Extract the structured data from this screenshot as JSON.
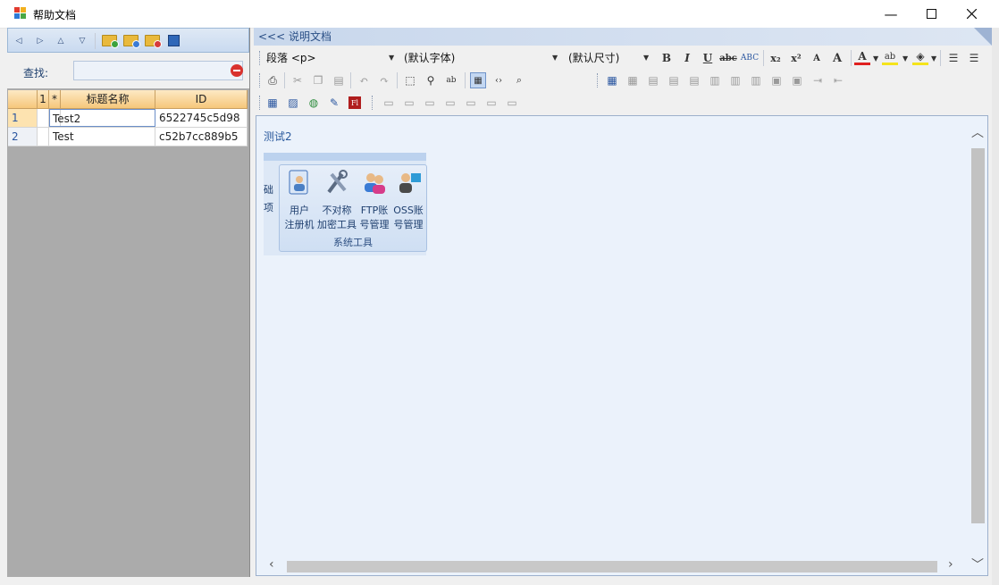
{
  "window": {
    "title": "帮助文档"
  },
  "left": {
    "search_label": "查找:",
    "search_value": "",
    "grid": {
      "head": {
        "sel": "",
        "col1": "1",
        "col2": "*",
        "title": "标题名称",
        "id": "ID"
      },
      "rows": [
        {
          "num": "1",
          "title": "Test2",
          "id": "6522745c5d98"
        },
        {
          "num": "2",
          "title": "Test",
          "id": "c52b7cc889b5"
        }
      ]
    }
  },
  "right": {
    "header": "<<< 说明文档",
    "toolbar": {
      "paragraph": "段落 <p>",
      "font": "(默认字体)",
      "size": "(默认尺寸)",
      "bold": "B",
      "italic": "I",
      "underline": "U",
      "strike": "abc",
      "subscript": "x₂",
      "superscript": "x²",
      "shrink": "A",
      "grow": "A",
      "font_color": "A",
      "highlight": "ab"
    },
    "editor": {
      "text": "测试2",
      "ribbon": {
        "items": [
          {
            "line1": "用户",
            "line2": "注册机"
          },
          {
            "line1": "不对称",
            "line2": "加密工具"
          },
          {
            "line1": "FTP账",
            "line2": "号管理"
          },
          {
            "line1": "OSS账",
            "line2": "号管理"
          }
        ],
        "group_label": "系统工具",
        "cut_left_1": "础",
        "cut_left_2": "项"
      }
    }
  },
  "colors": {
    "accent": "#2a56a0",
    "header_orange": "#f6c77b",
    "panel_blue": "#c9daf0"
  }
}
